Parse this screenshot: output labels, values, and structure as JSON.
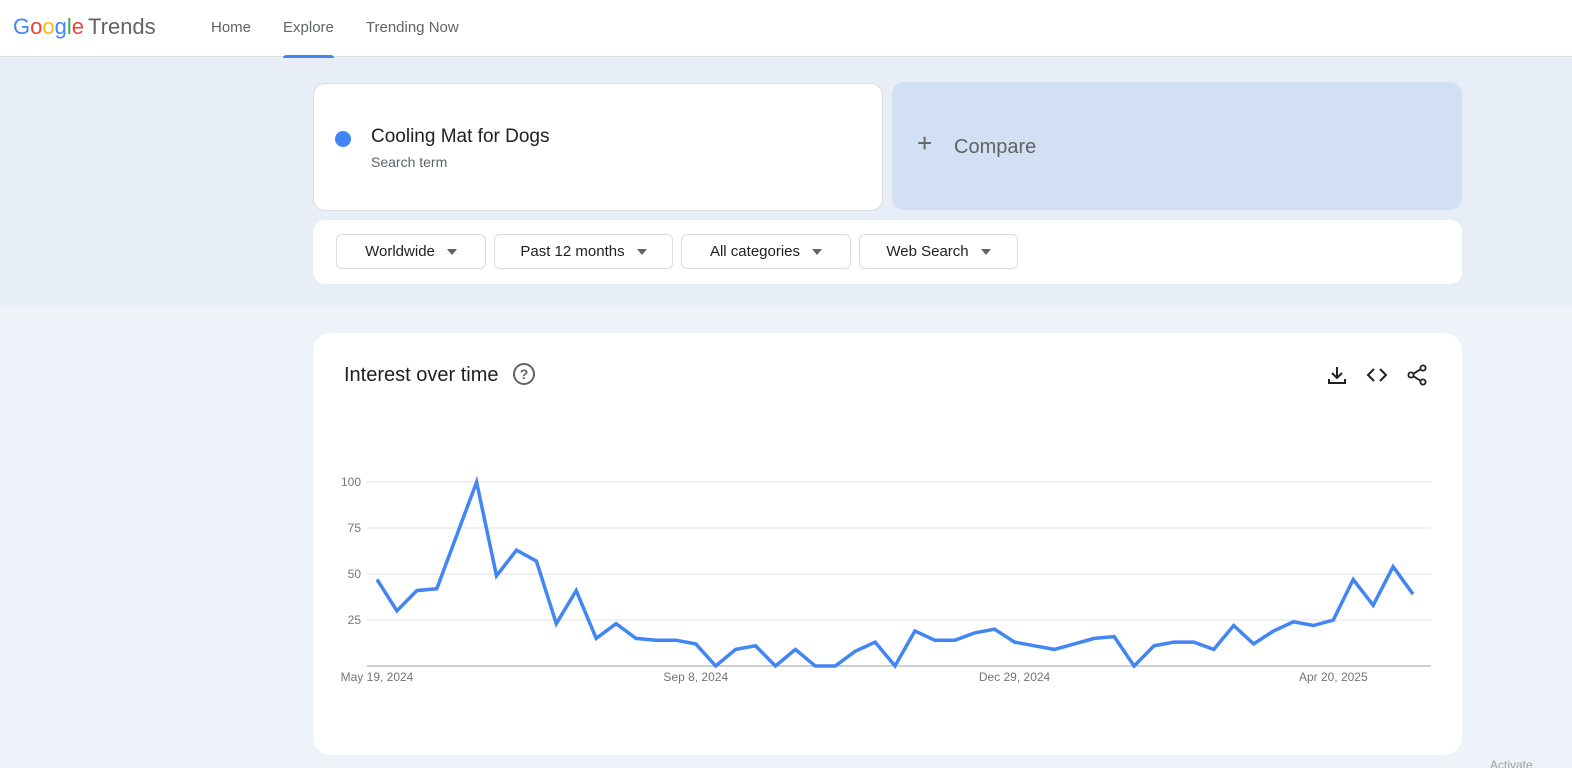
{
  "header": {
    "logo": {
      "google": "Google",
      "product": "Trends"
    },
    "nav": [
      {
        "label": "Home",
        "active": false
      },
      {
        "label": "Explore",
        "active": true
      },
      {
        "label": "Trending Now",
        "active": false
      }
    ]
  },
  "search": {
    "term": "Cooling Mat for Dogs",
    "term_type": "Search term",
    "term_color": "#4285f4",
    "compare_label": "Compare"
  },
  "filters": {
    "region": "Worldwide",
    "time": "Past 12 months",
    "category": "All categories",
    "property": "Web Search"
  },
  "chart_card": {
    "title": "Interest over time",
    "icons": [
      "help-icon",
      "download-icon",
      "embed-icon",
      "share-icon"
    ]
  },
  "chart_data": {
    "type": "line",
    "title": "Interest over time",
    "xlabel": "",
    "ylabel": "",
    "ylim": [
      0,
      100
    ],
    "y_ticks": [
      25,
      50,
      75,
      100
    ],
    "x_tick_labels": [
      "May 19, 2024",
      "Sep 8, 2024",
      "Dec 29, 2024",
      "Apr 20, 2025"
    ],
    "x_tick_indices": [
      0,
      16,
      32,
      48
    ],
    "grid": true,
    "series": [
      {
        "color": "#4285f4",
        "values": [
          47,
          30,
          41,
          42,
          71,
          100,
          49,
          63,
          57,
          23,
          41,
          15,
          23,
          15,
          14,
          14,
          12,
          0,
          9,
          11,
          0,
          9,
          0,
          0,
          8,
          13,
          0,
          19,
          14,
          14,
          18,
          20,
          13,
          11,
          9,
          12,
          15,
          16,
          0,
          11,
          13,
          13,
          9,
          22,
          12,
          19,
          24,
          22,
          25,
          47,
          33,
          54,
          39
        ]
      }
    ]
  },
  "footer": {
    "corner_text": "Activate"
  }
}
